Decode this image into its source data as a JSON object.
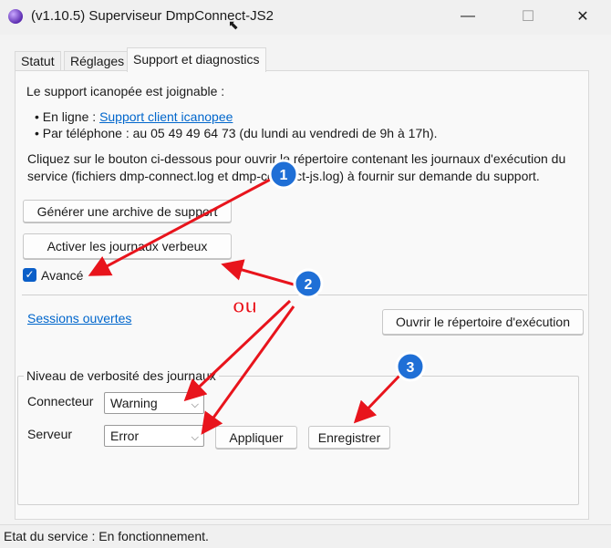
{
  "window": {
    "title": "(v1.10.5) Superviseur DmpConnect-JS2",
    "minimize_glyph": "—",
    "maximize_glyph": "☐",
    "close_glyph": "✕"
  },
  "tabs": [
    {
      "label": "Statut"
    },
    {
      "label": "Réglages"
    },
    {
      "label": "Support et diagnostics",
      "active": true
    }
  ],
  "support": {
    "intro": "Le support icanopée est joignable :",
    "online_prefix": "• En ligne : ",
    "online_link": "Support client icanopee",
    "phone": "• Par téléphone : au 05 49 49 64 73 (du lundi au vendredi de 9h à 17h).",
    "desc_line1": "Cliquez sur le bouton ci-dessous pour ouvrir le répertoire contenant les journaux d'exécution du",
    "desc_line2": "service (fichiers dmp-connect.log et dmp-connect-js.log) à fournir sur demande du support."
  },
  "buttons": {
    "generate_archive": "Générer une archive de support",
    "verbose_logs": "Activer les journaux verbeux",
    "open_exec_dir": "Ouvrir le répertoire d'exécution",
    "apply": "Appliquer",
    "save": "Enregistrer"
  },
  "advanced": {
    "label": "Avancé",
    "checked": true
  },
  "sessions_link": "Sessions ouvertes",
  "verbosity": {
    "group_label": "Niveau de verbosité des journaux",
    "connector_label": "Connecteur",
    "connector_value": "Warning",
    "server_label": "Serveur",
    "server_value": "Error"
  },
  "status_bar": "Etat du service : En fonctionnement.",
  "annotations": {
    "badge_1": "1",
    "badge_2": "2",
    "badge_3": "3",
    "ou": "ou",
    "arrow_color": "#e8141c",
    "badge_color": "#1f6fd6"
  }
}
